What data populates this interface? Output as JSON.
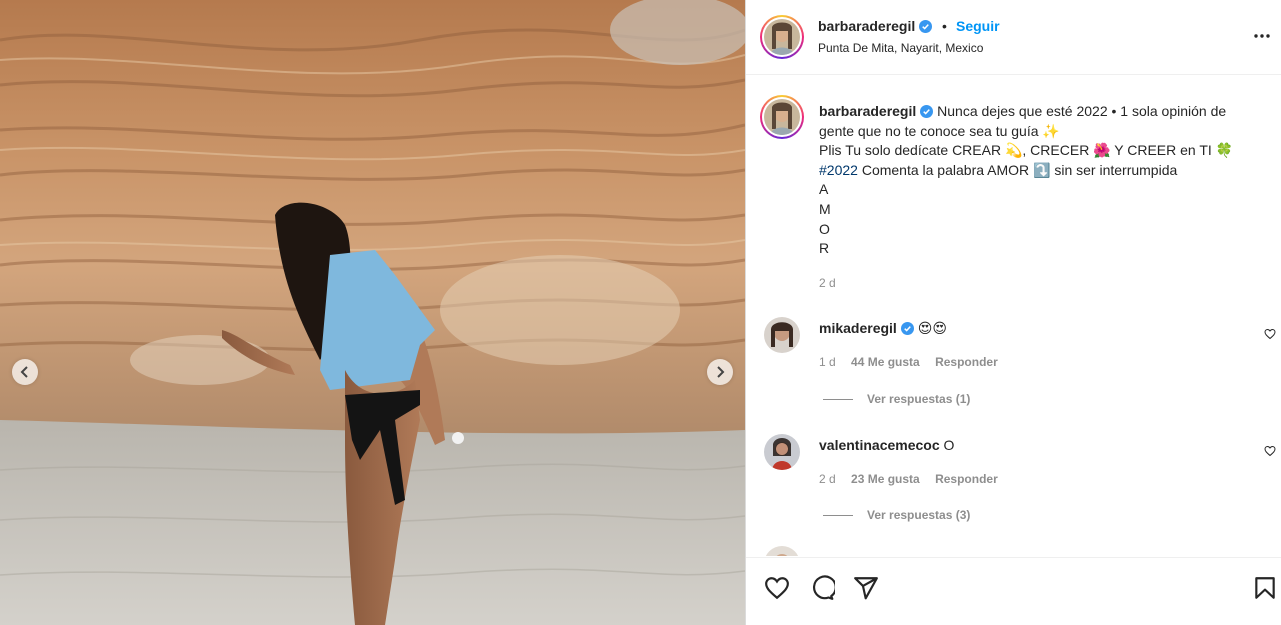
{
  "media": {
    "prev_icon": "chevron-left-icon",
    "next_icon": "chevron-right-icon"
  },
  "header": {
    "username": "barbaraderegil",
    "separator": "•",
    "follow_label": "Seguir",
    "location": "Punta De Mita, Nayarit, Mexico",
    "more_icon": "more-options-icon"
  },
  "caption": {
    "username": "barbaraderegil",
    "line1": "Nunca dejes que esté 2022 • 1 sola opinión de gente que no te conoce sea tu guía ✨",
    "line2": "Plis Tu solo dedícate CREAR 💫, CRECER 🌺 Y CREER en TI 🍀",
    "line3_tag": "#2022",
    "line3_rest": " Comenta la palabra AMOR ⤵️ sin ser interrumpida",
    "letters": [
      "A",
      "M",
      "O",
      "R"
    ],
    "time": "2 d"
  },
  "comments": [
    {
      "username": "mikaderegil",
      "verified": true,
      "text": "😍😍",
      "time": "1 d",
      "likes": "44 Me gusta",
      "reply_label": "Responder",
      "view_replies": "Ver respuestas (1)"
    },
    {
      "username": "valentinacemecoc",
      "verified": false,
      "text": "O",
      "time": "2 d",
      "likes": "23 Me gusta",
      "reply_label": "Responder",
      "view_replies": "Ver respuestas (3)"
    }
  ],
  "actions": {
    "like_icon": "heart-icon",
    "comment_icon": "comment-icon",
    "share_icon": "share-icon",
    "save_icon": "bookmark-icon"
  },
  "colors": {
    "link_blue": "#0095f6",
    "verified_blue": "#3897f0",
    "muted_gray": "#8e8e8e"
  }
}
